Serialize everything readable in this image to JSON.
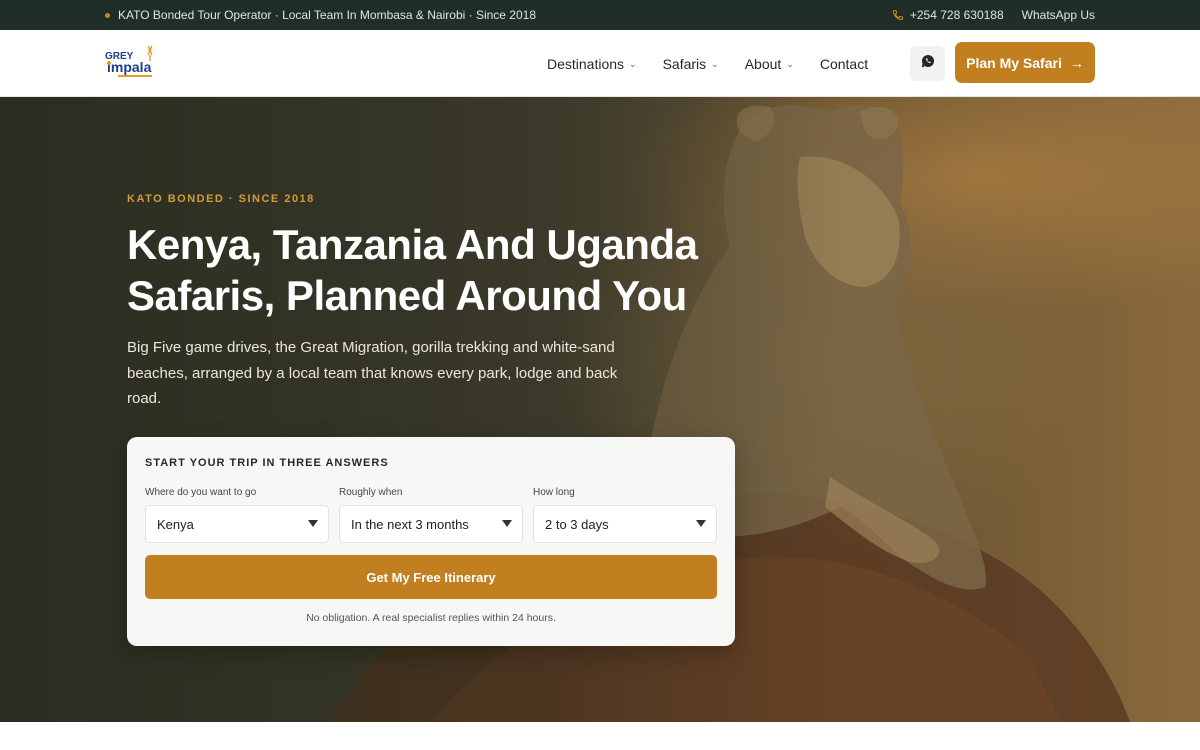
{
  "topbar": {
    "tagline": "KATO Bonded Tour Operator · Local Team In Mombasa & Nairobi · Since 2018",
    "phone": "+254 728 630188",
    "whatsapp": "WhatsApp Us"
  },
  "nav": {
    "logo_icon": "grey-impala-logo",
    "items": [
      {
        "label": "Destinations",
        "dropdown": true
      },
      {
        "label": "Safaris",
        "dropdown": true
      },
      {
        "label": "About",
        "dropdown": true
      },
      {
        "label": "Contact",
        "dropdown": false
      }
    ],
    "cta_label": "Plan My Safari",
    "cta_arrow": "→"
  },
  "hero": {
    "eyebrow": "KATO BONDED · SINCE 2018",
    "headline": "Kenya, Tanzania And Uganda Safaris, Planned Around You",
    "subtext": "Big Five game drives, the Great Migration, gorilla trekking and white-sand beaches, arranged by a local team that knows every park, lodge and back road."
  },
  "trip_form": {
    "title": "START YOUR TRIP IN THREE ANSWERS",
    "fields": [
      {
        "label": "Where do you want to go",
        "value": "Kenya"
      },
      {
        "label": "Roughly when",
        "value": "In the next 3 months"
      },
      {
        "label": "How long",
        "value": "2 to 3 days"
      }
    ],
    "submit_label": "Get My Free Itinerary",
    "note": "No obligation. A real specialist replies within 24 hours."
  },
  "colors": {
    "accent": "#c17f1f",
    "topbar_bg": "#1f2e28",
    "eyebrow": "#d49a3c"
  }
}
